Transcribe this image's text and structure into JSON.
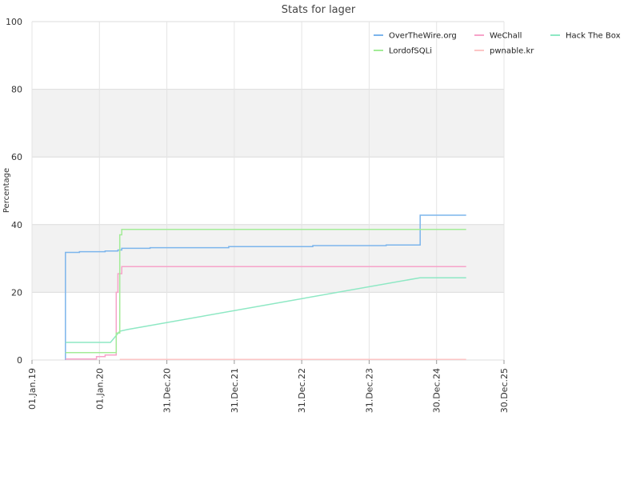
{
  "chart_data": {
    "type": "line",
    "title": "Stats for lager",
    "ylabel": "Percentage",
    "xlabel": "",
    "ylim": [
      0,
      100
    ],
    "yticks": [
      0,
      20,
      40,
      60,
      80,
      100
    ],
    "xlim": [
      "2019-01-01",
      "2025-12-30"
    ],
    "xticks": [
      {
        "date": "2019-01-01",
        "label": "01.Jan.19"
      },
      {
        "date": "2020-01-01",
        "label": "01.Jan.20"
      },
      {
        "date": "2020-12-31",
        "label": "31.Dec.20"
      },
      {
        "date": "2021-12-31",
        "label": "31.Dec.21"
      },
      {
        "date": "2022-12-31",
        "label": "31.Dec.22"
      },
      {
        "date": "2023-12-31",
        "label": "31.Dec.23"
      },
      {
        "date": "2024-12-30",
        "label": "30.Dec.24"
      },
      {
        "date": "2025-12-30",
        "label": "30.Dec.25"
      }
    ],
    "grid": true,
    "alternating_bands": true,
    "legend_position": "top-right",
    "series": [
      {
        "name": "OverTheWire.org",
        "color": "#7cb5ec",
        "step": true,
        "points": [
          [
            "2019-07-01",
            0
          ],
          [
            "2019-07-01",
            31.8
          ],
          [
            "2019-09-15",
            32.0
          ],
          [
            "2020-02-01",
            32.2
          ],
          [
            "2020-04-10",
            32.5
          ],
          [
            "2020-05-01",
            33.0
          ],
          [
            "2020-10-01",
            33.2
          ],
          [
            "2021-12-01",
            33.5
          ],
          [
            "2023-03-01",
            33.8
          ],
          [
            "2024-04-01",
            34.0
          ],
          [
            "2024-10-01",
            34.0
          ],
          [
            "2024-10-02",
            42.8
          ],
          [
            "2025-06-08",
            42.8
          ]
        ]
      },
      {
        "name": "WeChall",
        "color": "#f7a3c9",
        "step": true,
        "points": [
          [
            "2019-07-01",
            0.3
          ],
          [
            "2019-12-15",
            0.3
          ],
          [
            "2019-12-16",
            1.0
          ],
          [
            "2020-02-01",
            1.5
          ],
          [
            "2020-03-15",
            1.5
          ],
          [
            "2020-04-01",
            20.0
          ],
          [
            "2020-04-10",
            25.5
          ],
          [
            "2020-05-01",
            27.6
          ],
          [
            "2025-06-08",
            27.6
          ]
        ]
      },
      {
        "name": "Hack The Box",
        "color": "#8ee8c4",
        "step": false,
        "points": [
          [
            "2019-07-01",
            5.2
          ],
          [
            "2020-03-01",
            5.2
          ],
          [
            "2020-04-20",
            8.5
          ],
          [
            "2020-06-01",
            9.0
          ],
          [
            "2024-10-01",
            24.3
          ],
          [
            "2025-06-08",
            24.3
          ]
        ]
      },
      {
        "name": "LordofSQLi",
        "color": "#a3ec97",
        "step": true,
        "points": [
          [
            "2019-07-01",
            2.2
          ],
          [
            "2020-03-20",
            2.2
          ],
          [
            "2020-04-01",
            8.0
          ],
          [
            "2020-04-20",
            37.0
          ],
          [
            "2020-05-01",
            38.6
          ],
          [
            "2025-06-08",
            38.6
          ]
        ]
      },
      {
        "name": "pwnable.kr",
        "color": "#fcc5c5",
        "step": true,
        "points": [
          [
            "2020-04-20",
            0.2
          ],
          [
            "2025-06-08",
            0.2
          ]
        ]
      }
    ],
    "legend_order": [
      "OverTheWire.org",
      "WeChall",
      "Hack The Box",
      "LordofSQLi",
      "pwnable.kr"
    ]
  }
}
